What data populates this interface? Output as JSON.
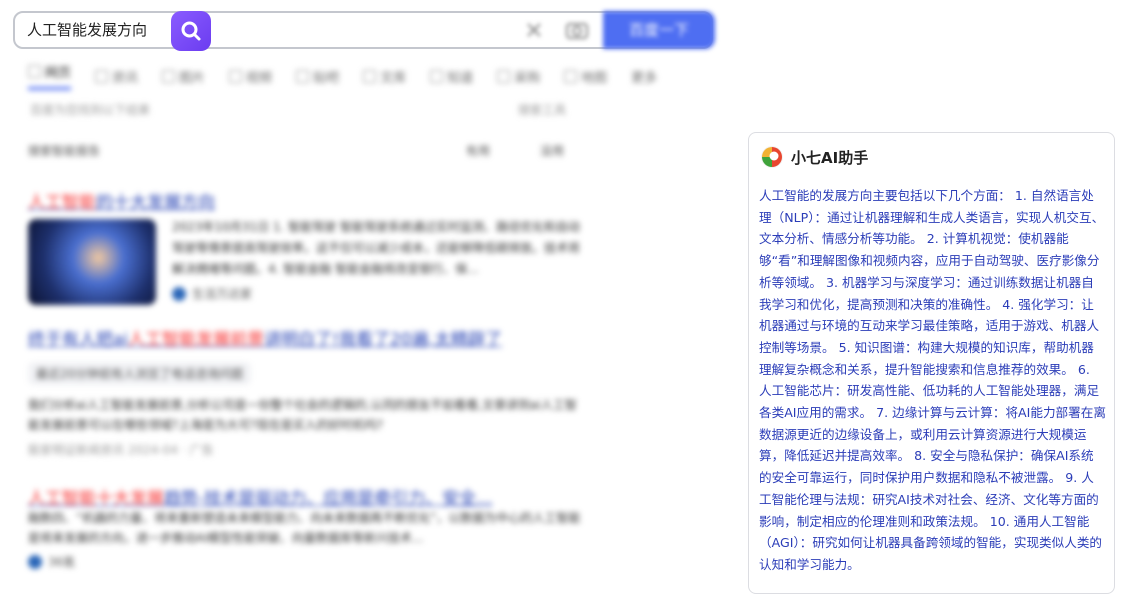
{
  "search": {
    "query": "人工智能发展方向",
    "button_label": "百度一下"
  },
  "tabs": [
    {
      "label": "网页",
      "active": true
    },
    {
      "label": "资讯"
    },
    {
      "label": "图片"
    },
    {
      "label": "视频"
    },
    {
      "label": "贴吧"
    },
    {
      "label": "文库"
    },
    {
      "label": "知道"
    },
    {
      "label": "采购"
    },
    {
      "label": "地图"
    },
    {
      "label": "更多"
    }
  ],
  "result_count": "百度为您找到以下结果",
  "search_tools": "搜索工具",
  "ai_notice": "搜索智能报告",
  "useful": "有用",
  "useless": "没用",
  "results": [
    {
      "title_em": "人工智能",
      "title_rest": "的十大发展方向",
      "date": "2023年10月31日",
      "snippet": "1. 智能驾驶 智能驾驶系统通过实时监测、路径优化和自动驾驶等情景提高驾驶效率。这不仅可以减少成本，还能够降低碳排放。技术将解决拥堵等问题。4. 智能金融 智能金融将改变银行、保...",
      "source": "生活万达家"
    },
    {
      "title_pre": "终于有人把ai",
      "title_em": "人工智能发展前景",
      "title_rest": "讲明白了!我看了20遍,太精辟了",
      "pill": "最近20分钟前有人浏览了电话咨询问题",
      "snippet": "我们分析ai人工智能发展前景,分析公司是一份整个社会的逻辑的,认同的朋友不如看看,文章讲到ai人工智能发展前景可以在哪些领域?上海是为大可?现在是买入的好时机吗?",
      "meta": "股家明证新闻资讯 2024-04",
      "ad": "广告"
    },
    {
      "title_em": "人工智能十大发展",
      "title_rest": "趋势-技术是驱动力、应用是牵引力、安全...",
      "snippet": "融数四、“机器的力量、将来重新塑造未来模型能力、向未来数据再不断优化”，以数据为中心的人工智能是将来发展的方向，进一步推动AI模型性能突破、向量数据库等新兴技术...",
      "source": "36氪"
    }
  ],
  "ai_card": {
    "name": "小七AI助手",
    "answer": "人工智能的发展方向主要包括以下几个方面： 1. 自然语言处理（NLP）：通过让机器理解和生成人类语言，实现人机交互、文本分析、情感分析等功能。 2. 计算机视觉：使机器能够“看”和理解图像和视频内容，应用于自动驾驶、医疗影像分析等领域。 3. 机器学习与深度学习：通过训练数据让机器自我学习和优化，提高预测和决策的准确性。 4. 强化学习：让机器通过与环境的互动来学习最佳策略，适用于游戏、机器人控制等场景。 5. 知识图谱：构建大规模的知识库，帮助机器理解复杂概念和关系，提升智能搜索和信息推荐的效果。 6. 人工智能芯片：研发高性能、低功耗的人工智能处理器，满足各类AI应用的需求。 7. 边缘计算与云计算：将AI能力部署在离数据源更近的边缘设备上，或利用云计算资源进行大规模运算，降低延迟并提高效率。 8. 安全与隐私保护：确保AI系统的安全可靠运行，同时保护用户数据和隐私不被泄露。 9. 人工智能伦理与法规：研究AI技术对社会、经济、文化等方面的影响，制定相应的伦理准则和政策法规。 10. 通用人工智能（AGI）：研究如何让机器具备跨领域的智能，实现类似人类的认知和学习能力。"
  },
  "colors": {
    "accent": "#4e6ef2",
    "link": "#2440b3",
    "highlight": "#f73131",
    "ai_text": "#2b3db8",
    "ai_badge": "#7c4dff"
  }
}
